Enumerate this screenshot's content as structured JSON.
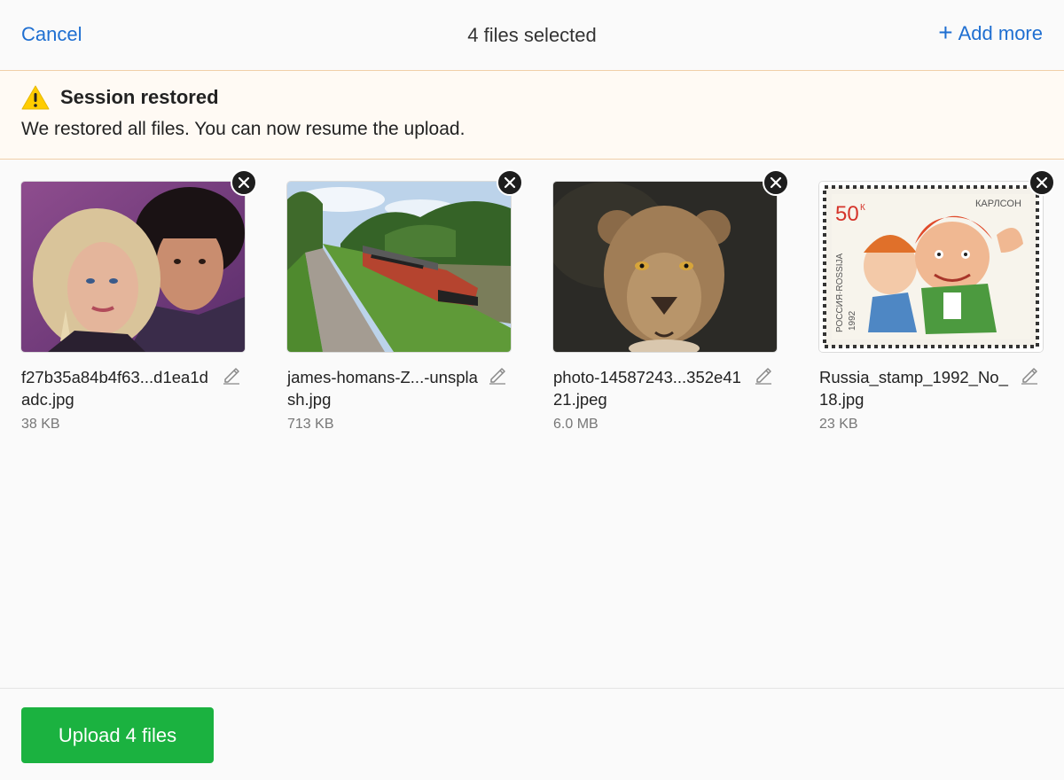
{
  "header": {
    "cancel_label": "Cancel",
    "title": "4 files selected",
    "add_more_label": "Add more",
    "add_icon": "plus-icon"
  },
  "banner": {
    "icon": "warning-icon",
    "title": "Session restored",
    "message": "We restored all files. You can now resume the upload."
  },
  "files": [
    {
      "name": "f27b35a84b4f63...d1ea1dadc.jpg",
      "size": "38 KB",
      "thumbnail": "portrait-couple-photo"
    },
    {
      "name": "james-homans-Z...-unsplash.jpg",
      "size": "713 KB",
      "thumbnail": "canal-boat-photo"
    },
    {
      "name": "photo-14587243...352e4121.jpeg",
      "size": "6.0 MB",
      "thumbnail": "lioness-photo"
    },
    {
      "name": "Russia_stamp_1992_No_18.jpg",
      "size": "23 KB",
      "thumbnail": "russian-stamp-photo",
      "thumbnail_text": {
        "value": "50",
        "unit": "К",
        "caption": "КАРЛСОН",
        "country": "РОССИЯ·ROSSIJA",
        "year": "1992"
      }
    }
  ],
  "footer": {
    "upload_label": "Upload 4 files"
  },
  "colors": {
    "accent": "#1f6fd1",
    "upload_button": "#1bb240",
    "banner_bg": "#fffaf4",
    "banner_border": "#f1cfa8",
    "warning": "#ffcc00"
  }
}
